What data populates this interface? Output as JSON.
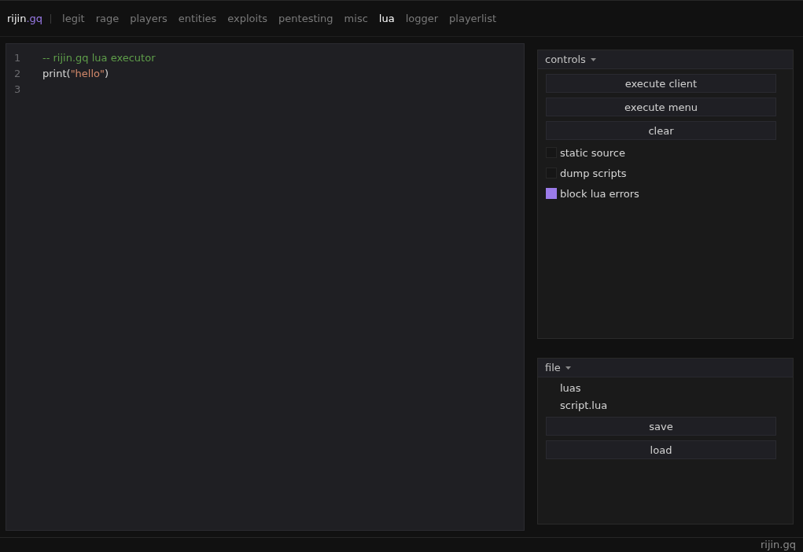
{
  "nav": {
    "brand": {
      "name": "rijin",
      "accent": ".gq"
    },
    "tabs": [
      {
        "label": "legit",
        "selected": false
      },
      {
        "label": "rage",
        "selected": false
      },
      {
        "label": "players",
        "selected": false
      },
      {
        "label": "entities",
        "selected": false
      },
      {
        "label": "exploits",
        "selected": false
      },
      {
        "label": "pentesting",
        "selected": false
      },
      {
        "label": "misc",
        "selected": false
      },
      {
        "label": "lua",
        "selected": true
      },
      {
        "label": "logger",
        "selected": false
      },
      {
        "label": "playerlist",
        "selected": false
      }
    ]
  },
  "editor": {
    "lines": [
      {
        "number": "1",
        "tokens": [
          {
            "kind": "comment",
            "text": "-- rijin.gq lua executor"
          }
        ]
      },
      {
        "number": "2",
        "tokens": [
          {
            "kind": "plain",
            "text": "print("
          },
          {
            "kind": "string",
            "text": "\"hello\""
          },
          {
            "kind": "plain",
            "text": ")"
          }
        ]
      },
      {
        "number": "3"
      }
    ]
  },
  "panels": [
    {
      "title": "controls",
      "items": [
        {
          "kind": "button",
          "label": "execute client"
        },
        {
          "kind": "button",
          "label": "execute menu"
        },
        {
          "kind": "button",
          "label": "clear"
        },
        {
          "kind": "checkbox",
          "label": "static source",
          "checked": false
        },
        {
          "kind": "checkbox",
          "label": "dump scripts",
          "checked": false
        },
        {
          "kind": "checkbox",
          "label": "block lua errors",
          "checked": true
        }
      ]
    },
    {
      "title": "file",
      "items": [
        {
          "kind": "list_item",
          "label": "luas"
        },
        {
          "kind": "list_item",
          "label": "script.lua"
        },
        {
          "kind": "button",
          "label": "save"
        },
        {
          "kind": "button",
          "label": "load"
        }
      ]
    }
  ],
  "status_bar": {
    "text": "rijin.gq"
  }
}
